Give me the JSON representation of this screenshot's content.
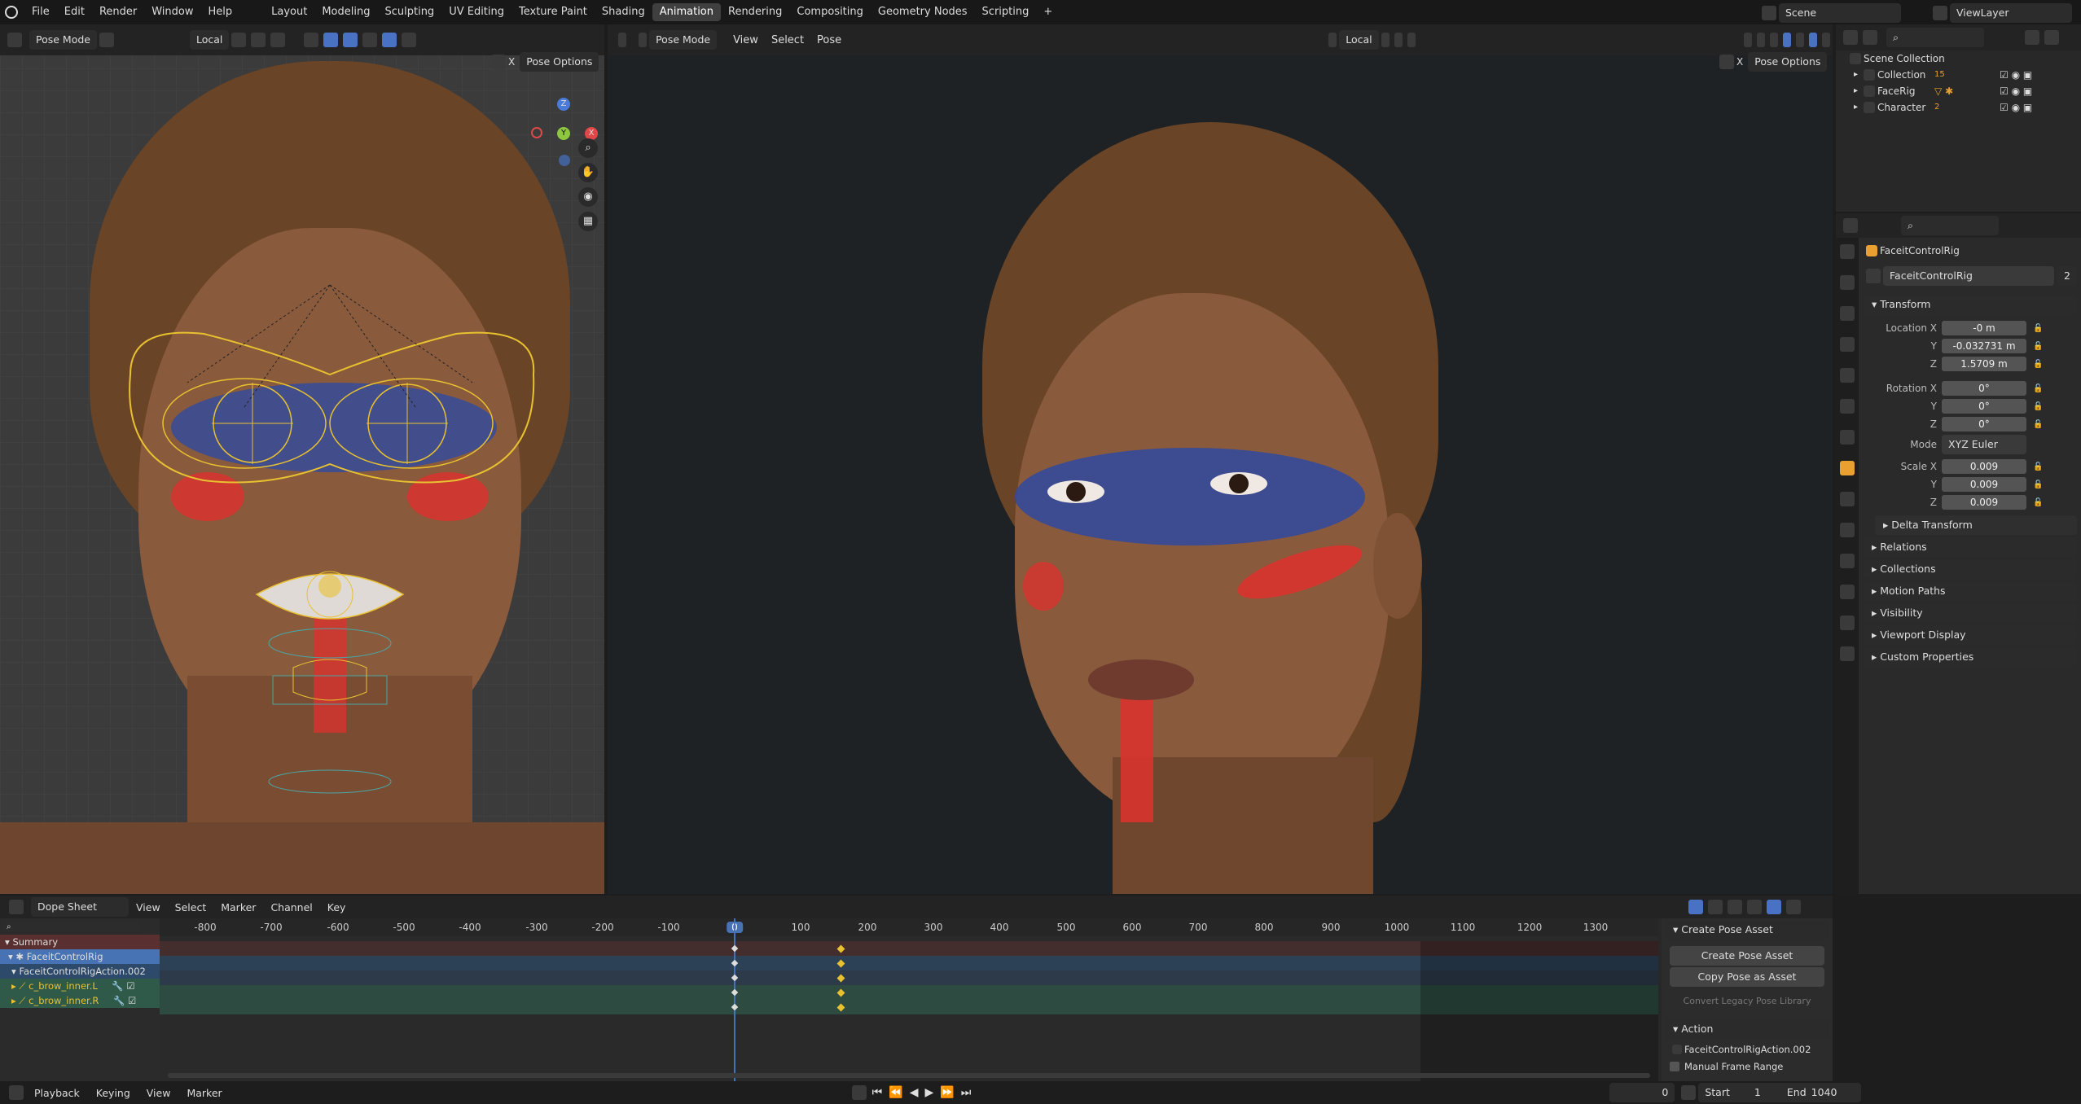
{
  "menu": [
    "File",
    "Edit",
    "Render",
    "Window",
    "Help"
  ],
  "workspaces": [
    "Layout",
    "Modeling",
    "Sculpting",
    "UV Editing",
    "Texture Paint",
    "Shading",
    "Animation",
    "Rendering",
    "Compositing",
    "Geometry Nodes",
    "Scripting"
  ],
  "active_workspace": "Animation",
  "scene": {
    "name": "Scene",
    "view_layer": "ViewLayer"
  },
  "left_viewport": {
    "mode": "Pose Mode",
    "orientation": "Local",
    "pose_options": "Pose Options",
    "x_label": "X"
  },
  "right_viewport": {
    "mode": "Pose Mode",
    "menus": [
      "View",
      "Select",
      "Pose"
    ],
    "orientation": "Local",
    "pose_options": "Pose Options",
    "x_label": "X"
  },
  "gizmo": {
    "z": "Z",
    "y": "Y",
    "x": "X"
  },
  "outliner": {
    "root": "Scene Collection",
    "items": [
      {
        "name": "Collection",
        "badge": "15"
      },
      {
        "name": "FaceRig",
        "badge": ""
      },
      {
        "name": "Character",
        "badge": "2"
      }
    ]
  },
  "properties": {
    "object_name": "FaceitControlRig",
    "data_name": "FaceitControlRig",
    "users": "2",
    "transform_title": "Transform",
    "location": {
      "label": "Location X",
      "x": "-0 m",
      "y": "-0.032731 m",
      "z": "1.5709 m"
    },
    "rotation": {
      "label": "Rotation X",
      "x": "0°",
      "y": "0°",
      "z": "0°"
    },
    "mode": {
      "label": "Mode",
      "value": "XYZ Euler"
    },
    "scale": {
      "label": "Scale X",
      "x": "0.009",
      "y": "0.009",
      "z": "0.009"
    },
    "axis_y": "Y",
    "axis_z": "Z",
    "delta": "Delta Transform",
    "sections": [
      "Relations",
      "Collections",
      "Motion Paths",
      "Visibility",
      "Viewport Display",
      "Custom Properties"
    ]
  },
  "dopesheet": {
    "editor": "Dope Sheet",
    "menus": [
      "View",
      "Select",
      "Marker",
      "Channel",
      "Key"
    ],
    "ruler": [
      "-800",
      "-700",
      "-600",
      "-500",
      "-400",
      "-300",
      "-200",
      "-100",
      "0",
      "100",
      "200",
      "300",
      "400",
      "500",
      "600",
      "700",
      "800",
      "900",
      "1000",
      "1100",
      "1200",
      "1300"
    ],
    "current_frame": "0",
    "channels": [
      {
        "name": "Summary"
      },
      {
        "name": "FaceitControlRig"
      },
      {
        "name": "FaceitControlRigAction.002"
      },
      {
        "name": "c_brow_inner.L"
      },
      {
        "name": "c_brow_inner.R"
      }
    ],
    "keys": [
      0,
      160
    ]
  },
  "sidepanel": {
    "create_pose_title": "Create Pose Asset",
    "create_pose_btn": "Create Pose Asset",
    "copy_pose_btn": "Copy Pose as Asset",
    "convert_btn": "Convert Legacy Pose Library",
    "action_title": "Action",
    "action_name": "FaceitControlRigAction.002",
    "manual_range": "Manual Frame Range"
  },
  "timeline": {
    "menus": [
      "Playback",
      "Keying",
      "View",
      "Marker"
    ],
    "frame": "0",
    "start_label": "Start",
    "start": "1",
    "end_label": "End",
    "end": "1040"
  },
  "colors": {
    "accent": "#4772b3",
    "active_orange": "#e8a030",
    "key_yellow": "#e8c130"
  }
}
